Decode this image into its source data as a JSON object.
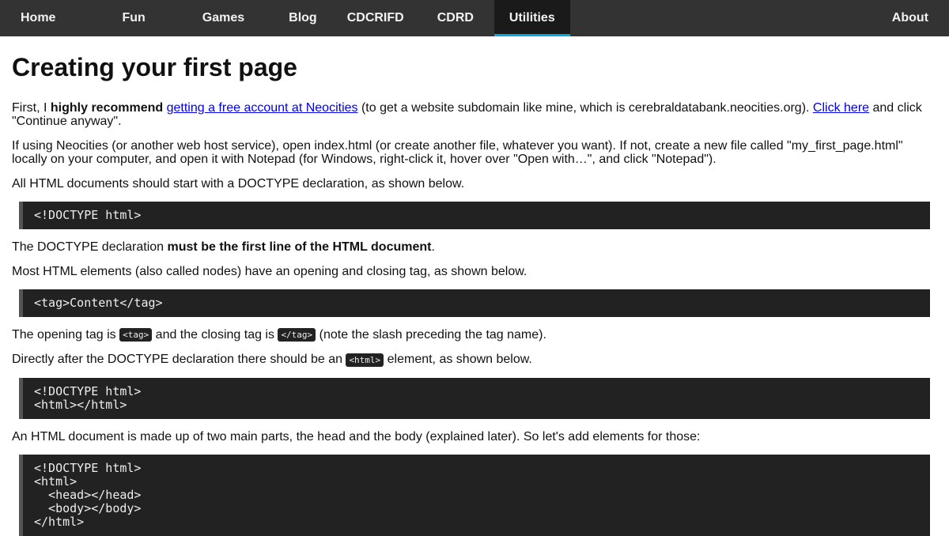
{
  "nav": {
    "items": [
      "Home",
      "Fun",
      "Games",
      "Blog",
      "CDCRIFD",
      "CDRD",
      "Utilities"
    ],
    "active_index": 6,
    "right_item": "About"
  },
  "page": {
    "title": "Creating your first page",
    "p1": {
      "t1": "First, I ",
      "bold": "highly recommend",
      "t2": " ",
      "link1": "getting a free account at Neocities",
      "t3": " (to get a website subdomain like mine, which is cerebraldatabank.neocities.org). ",
      "link2": "Click here",
      "t4": " and click \"Continue anyway\"."
    },
    "p2": "If using Neocities (or another web host service), open index.html (or create another file, whatever you want). If not, create a new file called \"my_first_page.html\" locally on your computer, and open it with Notepad (for Windows, right-click it, hover over \"Open with…\", and click \"Notepad\").",
    "p3": "All HTML documents should start with a DOCTYPE declaration, as shown below.",
    "code1": "<!DOCTYPE html>",
    "p4": {
      "t1": "The DOCTYPE declaration ",
      "bold": "must be the first line of the HTML document",
      "t2": "."
    },
    "p5": "Most HTML elements (also called nodes) have an opening and closing tag, as shown below.",
    "code2": "<tag>Content</tag>",
    "p6": {
      "t1": "The opening tag is ",
      "code_a": "<tag>",
      "t2": " and the closing tag is ",
      "code_b": "</tag>",
      "t3": " (note the slash preceding the tag name)."
    },
    "p7": {
      "t1": "Directly after the DOCTYPE declaration there should be an ",
      "code": "<html>",
      "t2": " element, as shown below."
    },
    "code3": "<!DOCTYPE html>\n<html></html>",
    "p8": "An HTML document is made up of two main parts, the head and the body (explained later). So let's add elements for those:",
    "code4": "<!DOCTYPE html>\n<html>\n  <head></head>\n  <body></body>\n</html>"
  },
  "colors": {
    "nav_bg": "#333333",
    "nav_active_bg": "#1a1a1a",
    "nav_active_accent": "#04aadd",
    "code_bg": "#222222",
    "link": "#0000ee"
  }
}
